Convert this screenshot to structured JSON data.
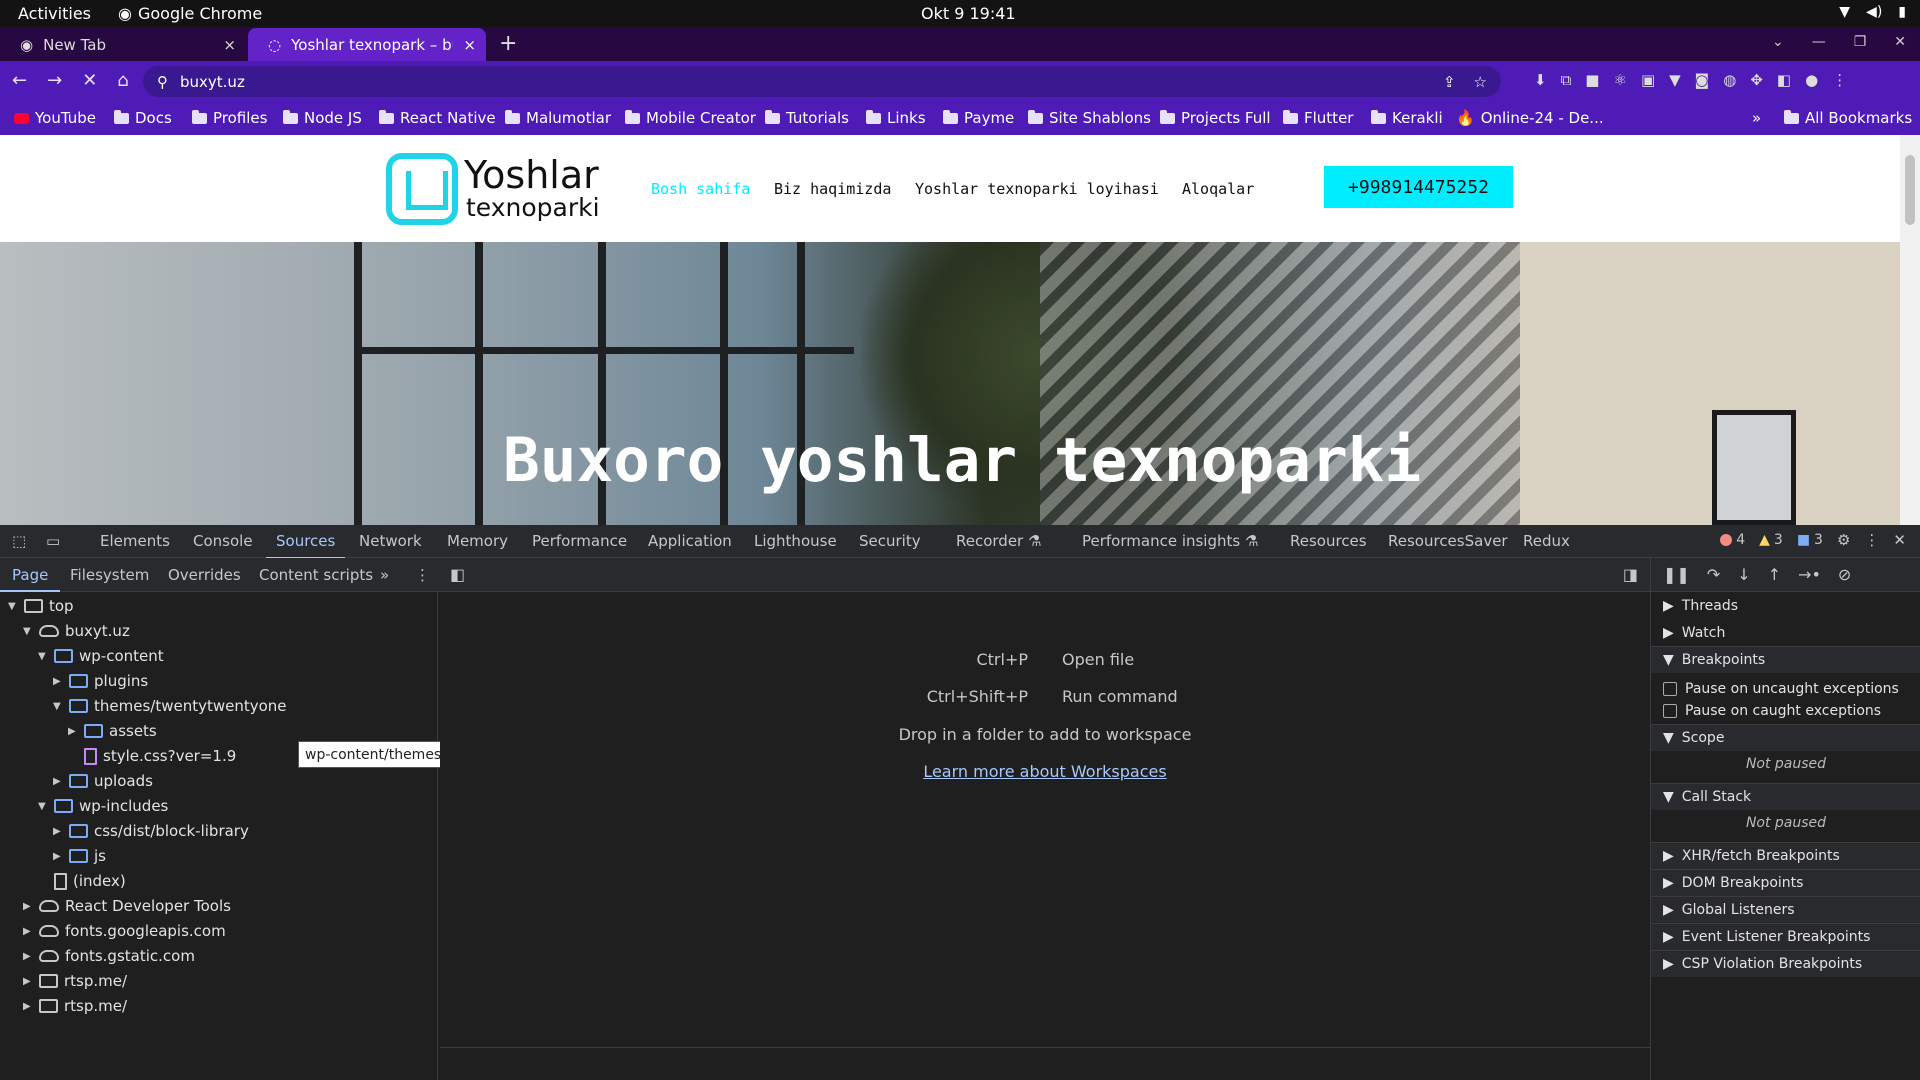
{
  "os_bar": {
    "activities": "Activities",
    "app_name": "Google Chrome",
    "clock": "Okt 9  19:41"
  },
  "tabs": [
    {
      "title": "New Tab",
      "close": "×"
    },
    {
      "title": "Yoshlar texnopark – buxyt.uz",
      "close": "×"
    }
  ],
  "new_tab": "+",
  "address": {
    "url": "buxyt.uz"
  },
  "bookmarks": [
    {
      "label": "YouTube",
      "icon": "youtube-icon"
    },
    {
      "label": "Docs",
      "icon": "folder-icon"
    },
    {
      "label": "Profiles",
      "icon": "folder-icon"
    },
    {
      "label": "Node JS",
      "icon": "folder-icon"
    },
    {
      "label": "React Native",
      "icon": "folder-icon"
    },
    {
      "label": "Malumotlar",
      "icon": "folder-icon"
    },
    {
      "label": "Mobile Creator",
      "icon": "folder-icon"
    },
    {
      "label": "Tutorials",
      "icon": "folder-icon"
    },
    {
      "label": "Links",
      "icon": "folder-icon"
    },
    {
      "label": "Payme",
      "icon": "folder-icon"
    },
    {
      "label": "Site Shablons",
      "icon": "folder-icon"
    },
    {
      "label": "Projects Full",
      "icon": "folder-icon"
    },
    {
      "label": "Flutter",
      "icon": "folder-icon"
    },
    {
      "label": "Kerakli",
      "icon": "folder-icon"
    },
    {
      "label": "Online-24 - De...",
      "icon": "flame-icon"
    }
  ],
  "bookmarks_more": "»",
  "all_bookmarks": "All Bookmarks",
  "site": {
    "logo_line1": "Yoshlar",
    "logo_line2": "texnoparki",
    "menu": [
      "Bosh sahifa",
      "Biz haqimizda",
      "Yoshlar texnoparki loyihasi",
      "Aloqalar"
    ],
    "phone": "+998914475252",
    "hero_title": "Buxoro yoshlar texnoparki",
    "accent": "#00ecff"
  },
  "devtools": {
    "tabs": [
      "Elements",
      "Console",
      "Sources",
      "Network",
      "Memory",
      "Performance",
      "Application",
      "Lighthouse",
      "Security",
      "Recorder ⚗",
      "Performance insights ⚗",
      "Resources",
      "ResourcesSaver",
      "Redux"
    ],
    "active_tab": "Sources",
    "errors": "4",
    "warnings": "3",
    "messages": "3",
    "sub_tabs": [
      "Page",
      "Filesystem",
      "Overrides",
      "Content scripts"
    ],
    "sub_more": "»",
    "tree": [
      {
        "label": "top",
        "icon": "frame-icon",
        "arrow": "▼"
      },
      {
        "label": "buxyt.uz",
        "icon": "cloud-icon",
        "arrow": "▼"
      },
      {
        "label": "wp-content",
        "icon": "folder-icon",
        "arrow": "▼"
      },
      {
        "label": "plugins",
        "icon": "folder-icon",
        "arrow": "▶"
      },
      {
        "label": "themes/twentytwentyone",
        "icon": "folder-icon",
        "arrow": "▼"
      },
      {
        "label": "assets",
        "icon": "folder-icon",
        "arrow": "▶"
      },
      {
        "label": "style.css?ver=1.9",
        "icon": "css-file-icon",
        "arrow": ""
      },
      {
        "label": "uploads",
        "icon": "folder-icon",
        "arrow": "▶"
      },
      {
        "label": "wp-includes",
        "icon": "folder-icon",
        "arrow": "▼"
      },
      {
        "label": "css/dist/block-library",
        "icon": "folder-icon",
        "arrow": "▶"
      },
      {
        "label": "js",
        "icon": "folder-icon",
        "arrow": "▶"
      },
      {
        "label": "(index)",
        "icon": "file-icon",
        "arrow": ""
      },
      {
        "label": "React Developer Tools",
        "icon": "cloud-icon",
        "arrow": "▶"
      },
      {
        "label": "fonts.googleapis.com",
        "icon": "cloud-icon",
        "arrow": "▶"
      },
      {
        "label": "fonts.gstatic.com",
        "icon": "cloud-icon",
        "arrow": "▶"
      },
      {
        "label": "rtsp.me/",
        "icon": "frame-icon",
        "arrow": "▶"
      },
      {
        "label": "rtsp.me/",
        "icon": "frame-icon",
        "arrow": "▶"
      }
    ],
    "tooltip": "wp-content/themes/twentytwentyone/assets",
    "shortcuts": [
      {
        "key": "Ctrl+P",
        "action": "Open file"
      },
      {
        "key": "Ctrl+Shift+P",
        "action": "Run command"
      }
    ],
    "drop_hint": "Drop in a folder to add to workspace",
    "learn_more": "Learn more about Workspaces",
    "debugger": {
      "threads": "Threads",
      "watch": "Watch",
      "breakpoints": "Breakpoints",
      "pause_uncaught": "Pause on uncaught exceptions",
      "pause_caught": "Pause on caught exceptions",
      "scope": "Scope",
      "scope_status": "Not paused",
      "call_stack": "Call Stack",
      "call_stack_status": "Not paused",
      "xhr": "XHR/fetch Breakpoints",
      "dom": "DOM Breakpoints",
      "global": "Global Listeners",
      "event": "Event Listener Breakpoints",
      "csp": "CSP Violation Breakpoints"
    }
  }
}
